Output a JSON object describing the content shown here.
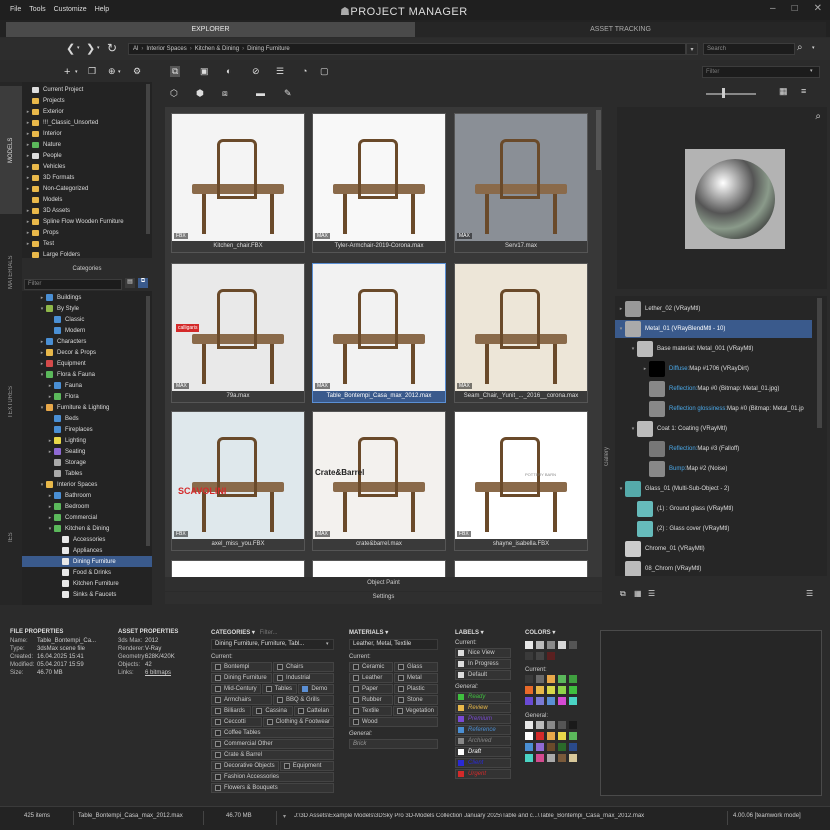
{
  "menu": [
    "File",
    "Tools",
    "Customize",
    "Help"
  ],
  "app_title": "PROJECT MANAGER",
  "window_controls": [
    "–",
    "□",
    "✕"
  ],
  "tabs": {
    "explorer": "EXPLORER",
    "asset_tracking": "ASSET TRACKING"
  },
  "breadcrumb": [
    "Al",
    "Interior Spaces",
    "Kitchen & Dining",
    "Dining Furniture"
  ],
  "search_placeholder": "Search",
  "filter_placeholder": "Filter",
  "side_tabs": [
    "MODELS",
    "MATERIALS",
    "TEXTURES",
    "IES"
  ],
  "folders": [
    {
      "label": "Current Project",
      "color": "#ddd",
      "arrow": ""
    },
    {
      "label": "Projects",
      "color": "#e8b84a",
      "arrow": ""
    },
    {
      "label": "Exterior",
      "color": "#e8b84a",
      "arrow": "▸"
    },
    {
      "label": "!!!_Classic_Unsorted",
      "color": "#e8b84a",
      "arrow": "▸"
    },
    {
      "label": "Interior",
      "color": "#e8b84a",
      "arrow": "▸"
    },
    {
      "label": "Nature",
      "color": "#5bb85b",
      "arrow": "▸"
    },
    {
      "label": "People",
      "color": "#ddd",
      "arrow": "▸"
    },
    {
      "label": "Vehicles",
      "color": "#e8b84a",
      "arrow": "▸"
    },
    {
      "label": "3D Formats",
      "color": "#e8b84a",
      "arrow": "▸"
    },
    {
      "label": "Non-Categorized",
      "color": "#e8b84a",
      "arrow": "▸"
    },
    {
      "label": "Models",
      "color": "#e8b84a",
      "arrow": ""
    },
    {
      "label": "3D Assets",
      "color": "#e8b84a",
      "arrow": "▸"
    },
    {
      "label": "Spline Flow Wooden Furniture",
      "color": "#e8b84a",
      "arrow": "▸"
    },
    {
      "label": "Props",
      "color": "#e8b84a",
      "arrow": "▸"
    },
    {
      "label": "Test",
      "color": "#e8b84a",
      "arrow": "▸"
    },
    {
      "label": "Large Folders",
      "color": "#e8b84a",
      "arrow": ""
    }
  ],
  "categories_header": "Categories",
  "categories_filter": "Filter",
  "categories": [
    {
      "label": "Buildings",
      "indent": 1,
      "arrow": "▸",
      "color": "#4a8fd4"
    },
    {
      "label": "By Style",
      "indent": 1,
      "arrow": "▾",
      "color": "#8fb84a"
    },
    {
      "label": "Classic",
      "indent": 2,
      "arrow": "",
      "color": "#4a8fd4"
    },
    {
      "label": "Modern",
      "indent": 2,
      "arrow": "",
      "color": "#4a8fd4"
    },
    {
      "label": "Characters",
      "indent": 1,
      "arrow": "▸",
      "color": "#4a8fd4"
    },
    {
      "label": "Decor & Props",
      "indent": 1,
      "arrow": "▸",
      "color": "#e8b84a"
    },
    {
      "label": "Equipment",
      "indent": 1,
      "arrow": "▸",
      "color": "#d44a4a"
    },
    {
      "label": "Flora & Fauna",
      "indent": 1,
      "arrow": "▾",
      "color": "#5bb85b"
    },
    {
      "label": "Fauna",
      "indent": 2,
      "arrow": "▸",
      "color": "#4a8fd4"
    },
    {
      "label": "Flora",
      "indent": 2,
      "arrow": "▸",
      "color": "#5bb85b"
    },
    {
      "label": "Furniture & Lighting",
      "indent": 1,
      "arrow": "▾",
      "color": "#e8a84a"
    },
    {
      "label": "Beds",
      "indent": 2,
      "arrow": "",
      "color": "#4a8fd4"
    },
    {
      "label": "Fireplaces",
      "indent": 2,
      "arrow": "",
      "color": "#4a8fd4"
    },
    {
      "label": "Lighting",
      "indent": 2,
      "arrow": "▸",
      "color": "#e8d84a"
    },
    {
      "label": "Seating",
      "indent": 2,
      "arrow": "▸",
      "color": "#8f6ad4"
    },
    {
      "label": "Storage",
      "indent": 2,
      "arrow": "",
      "color": "#aaa"
    },
    {
      "label": "Tables",
      "indent": 2,
      "arrow": "",
      "color": "#aaa"
    },
    {
      "label": "Interior Spaces",
      "indent": 1,
      "arrow": "▾",
      "color": "#e8b84a"
    },
    {
      "label": "Bathroom",
      "indent": 2,
      "arrow": "▸",
      "color": "#4a8fd4"
    },
    {
      "label": "Bedroom",
      "indent": 2,
      "arrow": "▸",
      "color": "#5bb85b"
    },
    {
      "label": "Commercial",
      "indent": 2,
      "arrow": "▸",
      "color": "#5bb85b"
    },
    {
      "label": "Kitchen & Dining",
      "indent": 2,
      "arrow": "▾",
      "color": "#5bb85b"
    },
    {
      "label": "Accessories",
      "indent": 3,
      "arrow": "",
      "color": "#e8e8e8"
    },
    {
      "label": "Appliances",
      "indent": 3,
      "arrow": "",
      "color": "#e8e8e8"
    },
    {
      "label": "Dining Furniture",
      "indent": 3,
      "arrow": "",
      "color": "#e8e8e8",
      "selected": true
    },
    {
      "label": "Food & Drinks",
      "indent": 3,
      "arrow": "",
      "color": "#e8e8e8"
    },
    {
      "label": "Kitchen Furniture",
      "indent": 3,
      "arrow": "",
      "color": "#e8e8e8"
    },
    {
      "label": "Sinks & Faucets",
      "indent": 3,
      "arrow": "",
      "color": "#e8e8e8"
    }
  ],
  "assets": [
    {
      "label": "Kitchen_chair.FBX",
      "fmt": "FBX",
      "bg": "#f4f4f4"
    },
    {
      "label": "Tyler-Armchair-2019-Corona.max",
      "fmt": "MAX",
      "bg": "#f8f8f8"
    },
    {
      "label": "Serv17.max",
      "fmt": "MAX",
      "bg": "#8a8f96"
    },
    {
      "label": "79a.max",
      "fmt": "MAX",
      "bg": "#e9e9e9"
    },
    {
      "label": "Table_Bontempi_Casa_max_2012.max",
      "fmt": "MAX",
      "bg": "#f2f2f2",
      "selected": true
    },
    {
      "label": "Seam_Chair,_Yunit_..._2016__corona.max",
      "fmt": "MAX",
      "bg": "#ede6d8"
    },
    {
      "label": "axel_miss_you.FBX",
      "fmt": "FBX",
      "bg": "#dfe8ec"
    },
    {
      "label": "crate&barrel.max",
      "fmt": "MAX",
      "bg": "#f3f1ee"
    },
    {
      "label": "shayne_isabella.FBX",
      "fmt": "FBX",
      "bg": "#ffffff"
    },
    {
      "label": "",
      "fmt": "",
      "bg": "#ffffff"
    },
    {
      "label": "",
      "fmt": "",
      "bg": "#ffffff"
    },
    {
      "label": "",
      "fmt": "",
      "bg": "#ffffff"
    }
  ],
  "brand_marks": {
    "scavolini": "SCAVOLINI",
    "crate": "Crate&Barrel",
    "calligaris": "calligaris",
    "potterybarn": "POTTERY BARN"
  },
  "object_paint": "Object Paint",
  "settings": "Settings",
  "gallery_label": "Gallery",
  "materials": [
    {
      "label": "Lether_02 (VRayMtl)",
      "indent": 0,
      "arrow": "▸",
      "swatch": "#999"
    },
    {
      "label": "Metal_01 (VRayBlendMtl - 10)",
      "indent": 0,
      "arrow": "▾",
      "swatch": "#aaa",
      "selected": true
    },
    {
      "label": "Base material: Metal_001 (VRayMtl)",
      "indent": 1,
      "arrow": "▾",
      "swatch": "#bbb"
    },
    {
      "label_prefix": "Diffuse: ",
      "label": "Map #1706 (VRayDirt)",
      "indent": 2,
      "arrow": "▸",
      "swatch": "#000",
      "link": true
    },
    {
      "label_prefix": "Reflection: ",
      "label": "Map #0 (Bitmap: Metal_01.jpg)",
      "indent": 2,
      "arrow": "",
      "swatch": "#888",
      "link": true
    },
    {
      "label_prefix": "Reflection glossiness: ",
      "label": "Map #0 (Bitmap: Metal_01.jp",
      "indent": 2,
      "arrow": "",
      "swatch": "#888",
      "link": true
    },
    {
      "label": "Coat 1: Coating (VRayMtl)",
      "indent": 1,
      "arrow": "▾",
      "swatch": "#bbb"
    },
    {
      "label_prefix": "Reflection: ",
      "label": "Map #3 (Falloff)",
      "indent": 2,
      "arrow": "",
      "swatch": "#777",
      "link": true
    },
    {
      "label_prefix": "Bump: ",
      "label": "Map #2 (Noise)",
      "indent": 2,
      "arrow": "",
      "swatch": "#888",
      "link": true
    },
    {
      "label": "Glass_01 (Multi-Sub-Object - 2)",
      "indent": 0,
      "arrow": "▾",
      "swatch": "#5aa"
    },
    {
      "label": "(1) : Ground glass (VRayMtl)",
      "indent": 1,
      "arrow": "",
      "swatch": "#6bb"
    },
    {
      "label": "(2) : Glass cover (VRayMtl)",
      "indent": 1,
      "arrow": "",
      "swatch": "#6bb"
    },
    {
      "label": "Chrome_01 (VRayMtl)",
      "indent": 0,
      "arrow": "",
      "swatch": "#ccc"
    },
    {
      "label": "08_Chrom (VRayMtl)",
      "indent": 0,
      "arrow": "",
      "swatch": "#bbb"
    }
  ],
  "file_properties": {
    "title": "FILE PROPERTIES",
    "rows": [
      [
        "Name:",
        "Table_Bontempi_Ca..."
      ],
      [
        "Type:",
        "3dsMax scene file"
      ],
      [
        "Created:",
        "16.04.2025 15:41"
      ],
      [
        "Modified:",
        "05.04.2017 15:59"
      ],
      [
        "Size:",
        "46.70 MB"
      ]
    ]
  },
  "asset_properties": {
    "title": "ASSET PROPERTIES",
    "rows": [
      [
        "3ds Max:",
        "2012"
      ],
      [
        "Renderer:",
        "V-Ray"
      ],
      [
        "Geometry:",
        "628K/420K"
      ],
      [
        "Objects:",
        "42"
      ],
      [
        "Links:",
        "6 bitmaps"
      ]
    ]
  },
  "categories_panel": {
    "title": "CATEGORIES ▾",
    "filter": "Filter...",
    "selected": "Dining Furniture, Furniture, Tabl...",
    "current_label": "Current:",
    "items": [
      [
        {
          "t": "Bontempi",
          "on": false
        },
        {
          "t": "Chairs",
          "on": false
        }
      ],
      [
        {
          "t": "Dining Furniture",
          "on": false
        },
        {
          "t": "Industrial",
          "on": false
        }
      ],
      [
        {
          "t": "Mid-Century",
          "on": false
        },
        {
          "t": "Tables",
          "on": false
        },
        {
          "t": "Demo",
          "on": true
        }
      ],
      [
        {
          "t": "Armchairs",
          "on": false
        },
        {
          "t": "BBQ & Grills",
          "on": false
        }
      ],
      [
        {
          "t": "Billiards",
          "on": false
        },
        {
          "t": "Cassina",
          "on": false
        },
        {
          "t": "Cattelan",
          "on": false
        }
      ],
      [
        {
          "t": "Ceccotti",
          "on": false
        },
        {
          "t": "Clothing & Footwear",
          "on": false
        }
      ],
      [
        {
          "t": "Coffee Tables",
          "on": false
        }
      ],
      [
        {
          "t": "Commercial Other",
          "on": false
        }
      ],
      [
        {
          "t": "Crate & Barrel",
          "on": false
        }
      ],
      [
        {
          "t": "Decorative Objects",
          "on": false
        },
        {
          "t": "Equipment",
          "on": false
        }
      ],
      [
        {
          "t": "Fashion Accessories",
          "on": false
        }
      ],
      [
        {
          "t": "Flowers & Bouquets",
          "on": false
        }
      ]
    ]
  },
  "materials_panel": {
    "title": "MATERIALS ▾",
    "selected": "Leather, Metal, Textile",
    "current_label": "Current:",
    "items": [
      [
        {
          "t": "Ceramic",
          "on": false
        },
        {
          "t": "Glass",
          "on": false
        }
      ],
      [
        {
          "t": "Leather",
          "on": false
        },
        {
          "t": "Metal",
          "on": false
        }
      ],
      [
        {
          "t": "Paper",
          "on": false
        },
        {
          "t": "Plastic",
          "on": false
        }
      ],
      [
        {
          "t": "Rubber",
          "on": false
        },
        {
          "t": "Stone",
          "on": false
        }
      ],
      [
        {
          "t": "Textile",
          "on": false
        },
        {
          "t": "Vegetation",
          "on": false
        }
      ],
      [
        {
          "t": "Wood",
          "on": false
        }
      ]
    ],
    "general_label": "General:",
    "general": [
      "Brick"
    ]
  },
  "labels_panel": {
    "title": "LABELS ▾",
    "current_label": "Current:",
    "current": [
      {
        "t": "Nice View",
        "c": "#ddd"
      },
      {
        "t": "In Progress",
        "c": "#ddd"
      },
      {
        "t": "Default",
        "c": "#ddd"
      }
    ],
    "general_label": "General:",
    "general": [
      {
        "t": "Ready",
        "c": "#3fbf3f"
      },
      {
        "t": "Review",
        "c": "#e8b84a"
      },
      {
        "t": "Premium",
        "c": "#7a4ad4"
      },
      {
        "t": "Reference",
        "c": "#4a8fd4"
      },
      {
        "t": "Archived",
        "c": "#888888"
      },
      {
        "t": "Draft",
        "c": "#ffffff"
      },
      {
        "t": "Client",
        "c": "#2a2ad4"
      },
      {
        "t": "Urgent",
        "c": "#d42a2a"
      }
    ]
  },
  "colors_panel": {
    "title": "COLORS ▾",
    "top": [
      "#e8e8e8",
      "#bbbbbb",
      "#8a8a8a",
      "#d8d8d8",
      "#555555",
      "#3a3a3a",
      "#444444",
      "#5a2020"
    ],
    "current_label": "Current:",
    "current": [
      "#3a3a3a",
      "#6a6a6a",
      "#e8a84a",
      "#5bb85b",
      "#3f9f3f",
      "#e86a2a",
      "#e8b84a",
      "#d8d84a",
      "#8fd44a",
      "#3fbf3f",
      "#6a4ad4",
      "#7a7ad4",
      "#5a8fd4",
      "#d44ad4",
      "#4ad4c4"
    ],
    "general_label": "General:",
    "general": [
      "#e8e8e8",
      "#bbbbbb",
      "#8a8a8a",
      "#555555",
      "#1a1a1a",
      "#ffffff",
      "#d42a2a",
      "#e8a84a",
      "#e8d84a",
      "#5bb85b",
      "#4a8fd4",
      "#8f6ad4",
      "#6a4a2a",
      "#2a6a2a",
      "#2a4a8a",
      "#4ad4c4",
      "#d44a8f",
      "#aaaaaa",
      "#7a5a3a",
      "#d8c89a"
    ]
  },
  "status": {
    "items": "425 items",
    "file": "Table_Bontempi_Casa_max_2012.max",
    "size": "46.70 MB",
    "path": "J:\\3D Assets\\Example Models\\3DSky Pro 3D-Models Collection January 2025\\Table and c...\\Table_Bontempi_Casa_max_2012.max",
    "version": "4.00.06 [teamwork mode]"
  }
}
